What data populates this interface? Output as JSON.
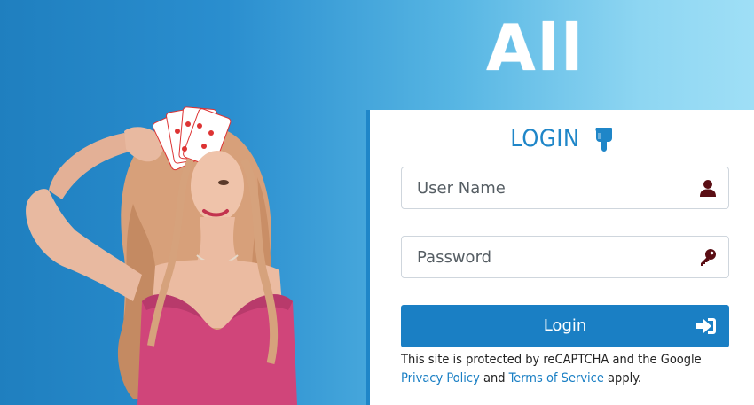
{
  "brand": {
    "text": "All"
  },
  "login": {
    "title": "LOGIN",
    "username": {
      "placeholder": "User Name",
      "value": ""
    },
    "password": {
      "placeholder": "Password",
      "value": ""
    },
    "button_label": "Login",
    "recaptcha": {
      "line1": "This site is protected by reCAPTCHA and the Google",
      "privacy_link": "Privacy Policy",
      "and": "and",
      "terms_link": "Terms of Service",
      "apply": "apply."
    }
  },
  "icons": {
    "title_icon": "hand-pointer-down-icon",
    "user_icon": "user-icon",
    "password_icon": "key-icon",
    "login_icon": "sign-in-icon"
  },
  "colors": {
    "accent": "#1f86c8",
    "button": "#1a7fc4",
    "icon_dark": "#5a0e14",
    "background_left": "#1f7fbf",
    "background_right": "#9fdff6"
  }
}
